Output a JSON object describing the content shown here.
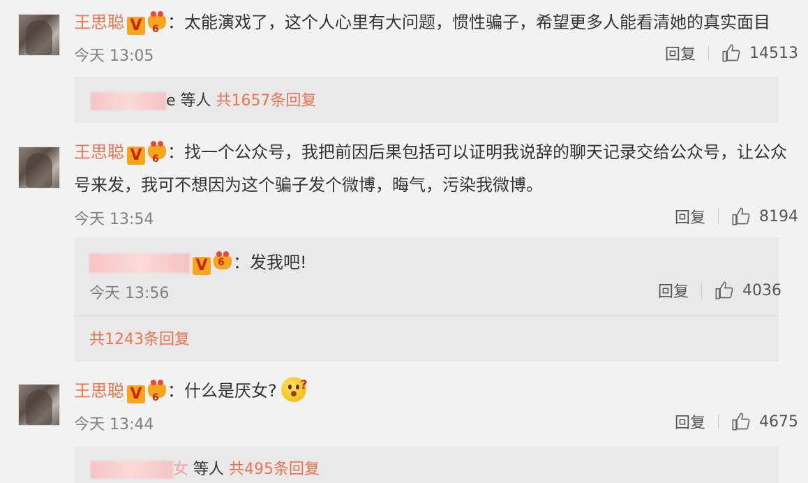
{
  "comments": [
    {
      "username": "王思聪",
      "vbadge": "V",
      "level": "6",
      "content": "太能演戏了，这个人心里有大问题，惯性骗子，希望更多人能看清她的真实面目",
      "time": "今天 13:05",
      "reply_label": "回复",
      "likes": "14513",
      "replies_summary_suffix": "e 等人",
      "replies_count": "共1657条回复"
    },
    {
      "username": "王思聪",
      "vbadge": "V",
      "level": "6",
      "content_line1": "找一个公众号，我把前因后果包括可以证明我说辞的聊天记录交给公众号，让公众",
      "content_line2": "号来发，我可不想因为这个骗子发个微博，晦气，污染我微博。",
      "time": "今天 13:54",
      "reply_label": "回复",
      "likes": "8194",
      "subreply": {
        "vbadge": "V",
        "level": "6",
        "content": "发我吧!",
        "time": "今天 13:56",
        "reply_label": "回复",
        "likes": "4036"
      },
      "replies_count": "共1243条回复"
    },
    {
      "username": "王思聪",
      "vbadge": "V",
      "level": "6",
      "content": "什么是厌女?",
      "time": "今天 13:44",
      "reply_label": "回复",
      "likes": "4675",
      "replies_summary_suffix_char": "女",
      "replies_summary_suffix": "等人",
      "replies_count": "共495条回复"
    }
  ],
  "colon": "：",
  "emoji_question": "?",
  "colors": {
    "username": "#eb7350",
    "background": "#f2f2f2",
    "replybox": "#e9e9e9"
  },
  "icons": {
    "like": "thumbs-up-icon",
    "vip": "v-badge-icon",
    "crown": "crown-level-icon",
    "emoji": "question-emoji-icon"
  }
}
